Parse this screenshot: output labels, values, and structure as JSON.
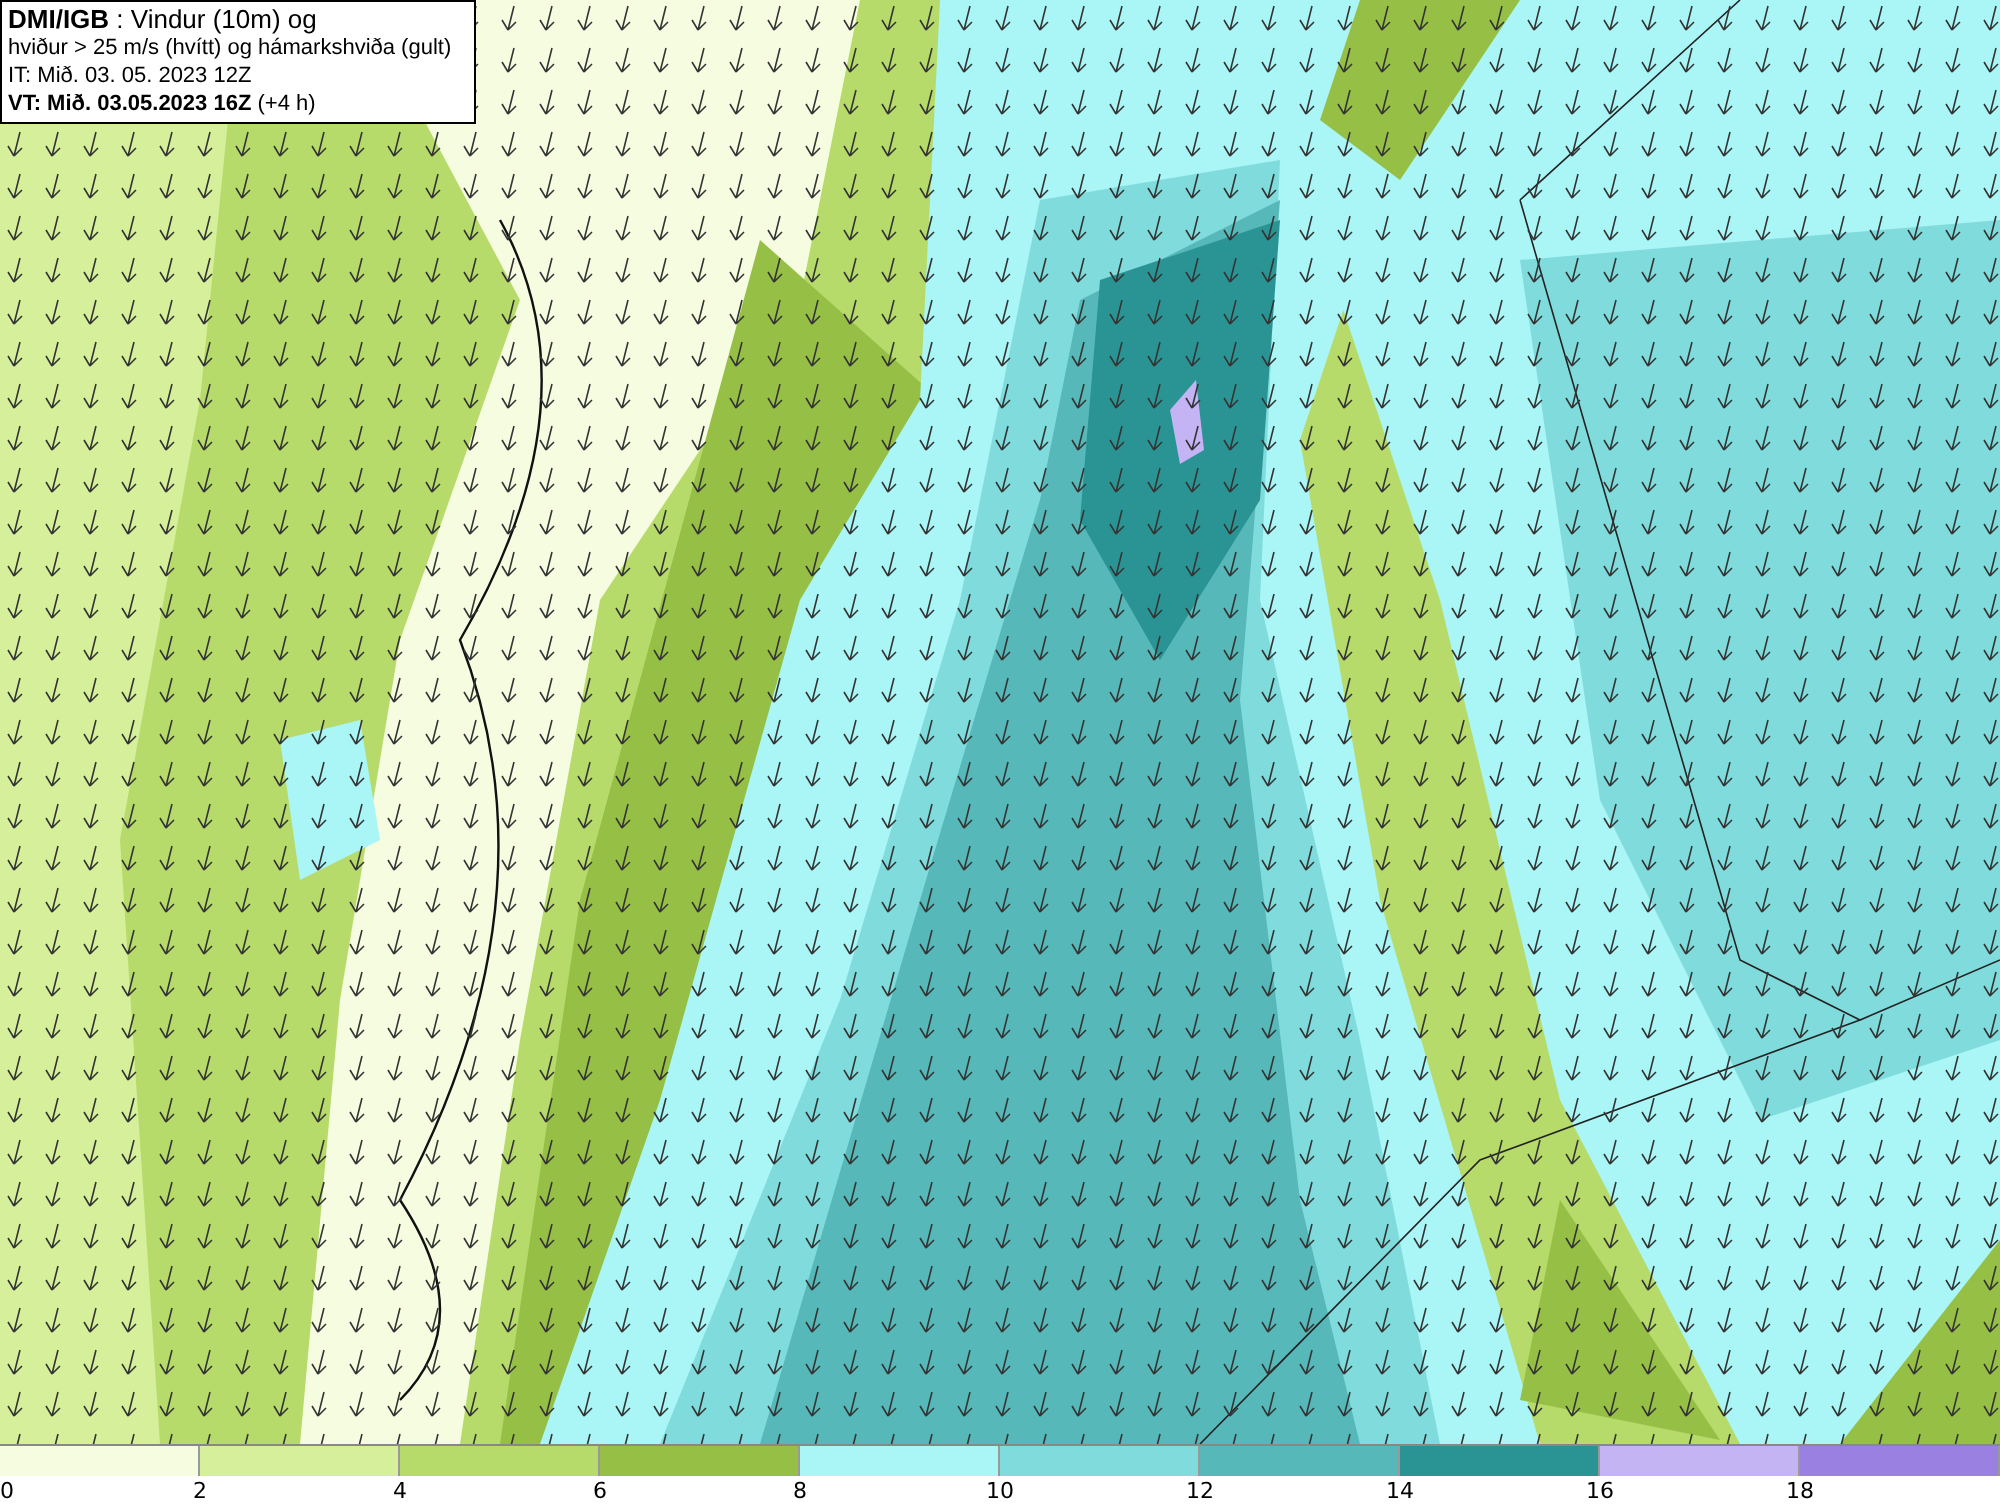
{
  "header": {
    "lines": [
      "**DMI/IGB** : Vindur (10m) og",
      "hviður > 25 m/s (hvítt) og hámarkshviða (gult)",
      "IT: Mið. 03. 05. 2023 12Z",
      "**VT: Mið. 03.05.2023 16Z** (+4 h)"
    ]
  },
  "legend": [
    {
      "label": "0",
      "color": "#f5fce0"
    },
    {
      "label": "2",
      "color": "#d6ef9a"
    },
    {
      "label": "4",
      "color": "#b6db6a"
    },
    {
      "label": "6",
      "color": "#96bf46"
    },
    {
      "label": "8",
      "color": "#aaf5f5"
    },
    {
      "label": "10",
      "color": "#80dcdc"
    },
    {
      "label": "12",
      "color": "#56b8b8"
    },
    {
      "label": "14",
      "color": "#2a9494"
    },
    {
      "label": "16",
      "color": "#c4b4f4"
    },
    {
      "label": "18",
      "color": "#9a80e0"
    }
  ]
}
